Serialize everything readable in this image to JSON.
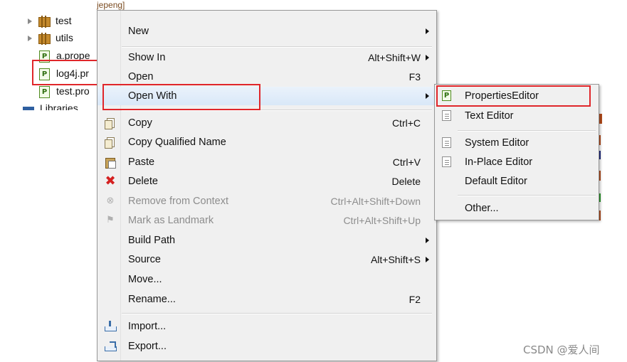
{
  "tree": {
    "items": [
      {
        "label": "test",
        "icon": "package-icon"
      },
      {
        "label": "utils",
        "icon": "package-icon"
      },
      {
        "label": "a.prope",
        "icon": "properties-file-icon"
      },
      {
        "label": "log4j.pr",
        "icon": "properties-file-icon"
      },
      {
        "label": "test.pro",
        "icon": "properties-file-icon"
      },
      {
        "label": "Libraries",
        "icon": "library-icon"
      }
    ],
    "file_icon_glyph": "P"
  },
  "background": {
    "fragment_text": "jepeng]"
  },
  "context_menu": {
    "items": [
      {
        "label": "New",
        "accelerator": "",
        "submenu": true
      },
      {
        "label": "Show In",
        "accelerator": "Alt+Shift+W",
        "submenu": true
      },
      {
        "label": "Open",
        "accelerator": "F3",
        "submenu": false
      },
      {
        "label": "Open With",
        "accelerator": "",
        "submenu": true,
        "highlighted": true
      },
      {
        "label": "Copy",
        "accelerator": "Ctrl+C",
        "icon": "copy-icon"
      },
      {
        "label": "Copy Qualified Name",
        "accelerator": "",
        "icon": "copy-qualified-name-icon"
      },
      {
        "label": "Paste",
        "accelerator": "Ctrl+V",
        "icon": "paste-icon"
      },
      {
        "label": "Delete",
        "accelerator": "Delete",
        "icon": "delete-icon",
        "icon_glyph": "✖"
      },
      {
        "label": "Remove from Context",
        "accelerator": "Ctrl+Alt+Shift+Down",
        "disabled": true,
        "icon": "remove-context-icon",
        "icon_glyph": "⊗"
      },
      {
        "label": "Mark as Landmark",
        "accelerator": "Ctrl+Alt+Shift+Up",
        "disabled": true,
        "icon": "landmark-icon",
        "icon_glyph": "⚑"
      },
      {
        "label": "Build Path",
        "accelerator": "",
        "submenu": true
      },
      {
        "label": "Source",
        "accelerator": "Alt+Shift+S",
        "submenu": true
      },
      {
        "label": "Move...",
        "accelerator": ""
      },
      {
        "label": "Rename...",
        "accelerator": "F2"
      },
      {
        "label": "Import...",
        "accelerator": "",
        "icon": "import-icon"
      },
      {
        "label": "Export...",
        "accelerator": "",
        "icon": "export-icon"
      }
    ]
  },
  "open_with_submenu": {
    "items": [
      {
        "label": "PropertiesEditor",
        "icon": "properties-editor-icon",
        "icon_glyph": "P",
        "highlighted": true
      },
      {
        "label": "Text Editor",
        "icon": "text-editor-icon"
      },
      {
        "label": "System Editor",
        "icon": "system-editor-icon"
      },
      {
        "label": "In-Place Editor",
        "icon": "in-place-editor-icon"
      },
      {
        "label": "Default Editor",
        "icon": ""
      },
      {
        "label": "Other...",
        "icon": ""
      }
    ]
  },
  "watermark": "CSDN @爱人间",
  "colors": {
    "highlight_box": "#e0262a",
    "menu_background": "#f0f0f0",
    "hover_background": "#d9e8f8",
    "disabled_text": "#8d8d8d"
  }
}
